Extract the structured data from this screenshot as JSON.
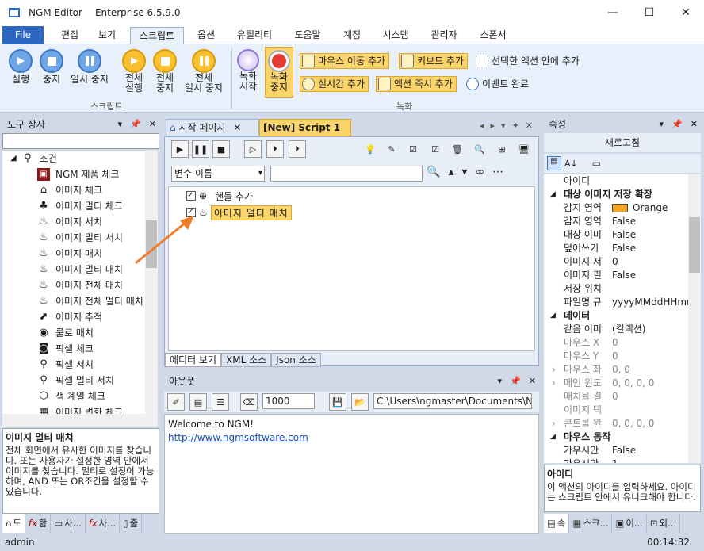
{
  "window": {
    "app_name": "NGM Editor",
    "edition": "Enterprise 6.5.9.0",
    "minimize": "—",
    "maximize": "☐",
    "close": "✕"
  },
  "menu": {
    "file": "File",
    "tabs": [
      "편집",
      "보기",
      "스크립트",
      "옵션",
      "유틸리티",
      "도움말",
      "계정",
      "시스템",
      "관리자",
      "스폰서"
    ]
  },
  "ribbon": {
    "run": "실행",
    "stop": "중지",
    "pause": "일시 중지",
    "all_run_1": "전체",
    "all_run_2": "실행",
    "all_stop_1": "전체",
    "all_stop_2": "중지",
    "all_pause_1": "전체",
    "all_pause_2": "일시 중지",
    "script_group": "스크립트",
    "rec_start_1": "녹화",
    "rec_start_2": "시작",
    "rec_stop_1": "녹화",
    "rec_stop_2": "중지",
    "mouse_move_add": "마우스 이동 추가",
    "keyboard_add": "키보드 추가",
    "in_selected_action_add": "선택한 액션 안에 추가",
    "realtime_add": "실시간 추가",
    "action_instant_add": "액션 즉시 추가",
    "event_done": "이벤트 완료",
    "record_group": "녹화"
  },
  "toolbox": {
    "title": "도구 상자",
    "category": "조건",
    "items": [
      "NGM 제품 체크",
      "이미지 체크",
      "이미지 멀티 체크",
      "이미지 서치",
      "이미지 멀티 서치",
      "이미지 매치",
      "이미지 멀티 매치",
      "이미지 전체 매치",
      "이미지 전체 멀티 매치",
      "이미지 추적",
      "룰로 매치",
      "픽셀 체크",
      "픽셀 서치",
      "픽셀 멀티 서치",
      "색 계열 체크",
      "이미지 변화 체크"
    ],
    "desc_title": "이미지 멀티 매치",
    "desc_body": "전체 화면에서 유사한 이미지를 찾습니다. 또는 사용자가 설정한 영역 안에서 이미지를 찾습니다. 멀티로 설정이 가능하며, AND 또는 OR조건을 설정할 수 있습니다.",
    "bottom_tabs": [
      "도",
      "함",
      "사...",
      "사...",
      "줄"
    ]
  },
  "editor": {
    "tab_start": "시작 페이지",
    "tab_script": "[New] Script 1",
    "tab_close": "✕",
    "var_select": "변수 이름",
    "search_value": "",
    "lines": [
      {
        "label": "핸들 추가",
        "checked": true
      },
      {
        "label": "이미지 멀티 매치",
        "checked": true
      }
    ],
    "view_tabs": [
      "에디터 보기",
      "XML 소스",
      "Json 소스"
    ]
  },
  "output": {
    "title": "아웃풋",
    "count": "1000",
    "path": "C:\\Users\\ngmaster\\Documents\\NGM",
    "welcome": "Welcome to NGM!",
    "link": "http://www.ngmsoftware.com"
  },
  "properties": {
    "title": "속성",
    "refresh": "새로고침",
    "rows": [
      {
        "type": "prop",
        "key": "아이디",
        "value": ""
      },
      {
        "type": "cat",
        "key": "대상 이미지 저장 확장"
      },
      {
        "type": "prop",
        "key": "감지 영역",
        "value": "Orange",
        "swatch": "#f5a623"
      },
      {
        "type": "prop",
        "key": "감지 영역",
        "value": "False"
      },
      {
        "type": "prop",
        "key": "대상 이미",
        "value": "False"
      },
      {
        "type": "prop",
        "key": "덮어쓰기",
        "value": "False"
      },
      {
        "type": "prop",
        "key": "이미지 저",
        "value": "0"
      },
      {
        "type": "prop",
        "key": "이미지 필",
        "value": "False"
      },
      {
        "type": "prop",
        "key": "저장 위치",
        "value": ""
      },
      {
        "type": "prop",
        "key": "파일명 규",
        "value": "yyyyMMddHHmm"
      },
      {
        "type": "cat",
        "key": "데이터"
      },
      {
        "type": "prop",
        "key": "같음 이미",
        "value": "(컬렉션)"
      },
      {
        "type": "gray",
        "key": "마우스 X",
        "value": "0"
      },
      {
        "type": "gray",
        "key": "마우스 Y",
        "value": "0"
      },
      {
        "type": "gray",
        "key": "마우스 좌",
        "value": "0, 0"
      },
      {
        "type": "gray",
        "key": "메인 윈도",
        "value": "0, 0, 0, 0"
      },
      {
        "type": "gray",
        "key": "매치율 결",
        "value": "0"
      },
      {
        "type": "gray",
        "key": "이미지 텍",
        "value": ""
      },
      {
        "type": "gray",
        "key": "콘트롤 윈",
        "value": "0, 0, 0, 0"
      },
      {
        "type": "cat",
        "key": "마우스 동작"
      },
      {
        "type": "prop",
        "key": "가우시안",
        "value": "False"
      },
      {
        "type": "prop",
        "key": "가우시안",
        "value": "1"
      }
    ],
    "desc_title": "아이디",
    "desc_body": "이 액션의 아이디를 입력하세요. 아이디는 스크립트 안에서 유니크해야 합니다.",
    "bottom_tabs": [
      "속",
      "스크...",
      "이...",
      "외..."
    ]
  },
  "status": {
    "user": "admin",
    "time": "00:14:32"
  },
  "colors": {
    "accent": "#2b67c0",
    "highlight": "#fbd56b",
    "arrow": "#f07c2a"
  }
}
